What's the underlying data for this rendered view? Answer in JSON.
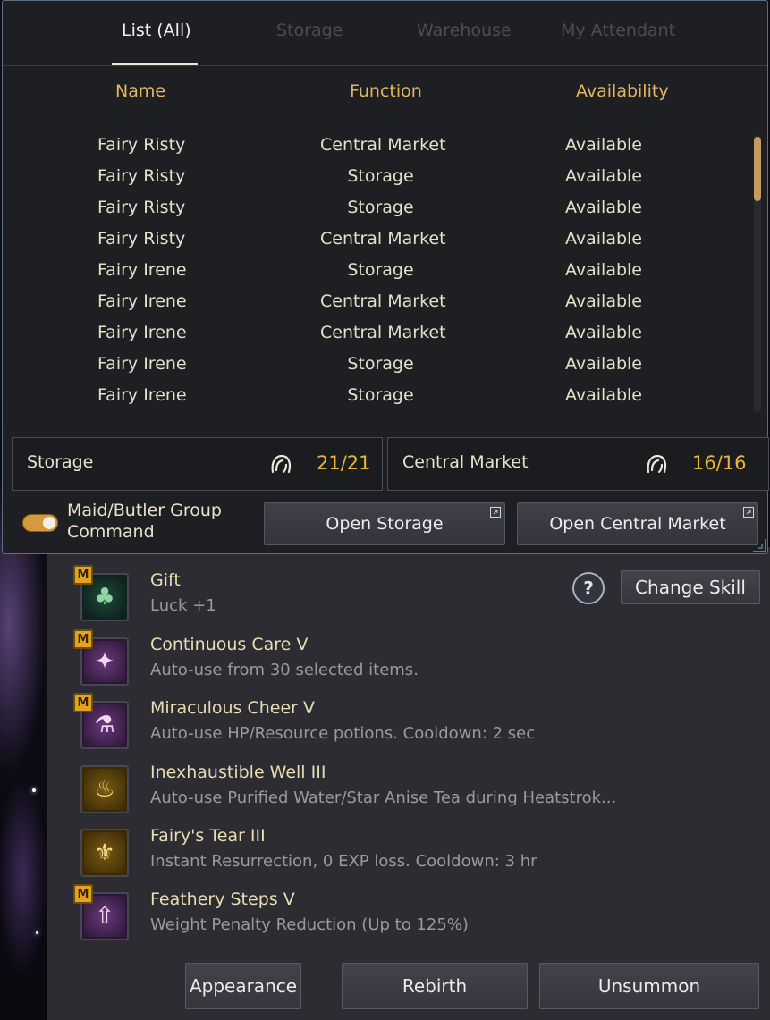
{
  "tabs": [
    {
      "label": "List (All)",
      "active": true
    },
    {
      "label": "Storage",
      "active": false
    },
    {
      "label": "Warehouse",
      "active": false
    },
    {
      "label": "My Attendant",
      "active": false
    }
  ],
  "columns": {
    "name": "Name",
    "function": "Function",
    "availability": "Availability"
  },
  "rows": [
    {
      "name": "Fairy Risty",
      "function": "Central Market",
      "availability": "Available"
    },
    {
      "name": "Fairy Risty",
      "function": "Storage",
      "availability": "Available"
    },
    {
      "name": "Fairy Risty",
      "function": "Storage",
      "availability": "Available"
    },
    {
      "name": "Fairy Risty",
      "function": "Central Market",
      "availability": "Available"
    },
    {
      "name": "Fairy Irene",
      "function": "Storage",
      "availability": "Available"
    },
    {
      "name": "Fairy Irene",
      "function": "Central Market",
      "availability": "Available"
    },
    {
      "name": "Fairy Irene",
      "function": "Central Market",
      "availability": "Available"
    },
    {
      "name": "Fairy Irene",
      "function": "Storage",
      "availability": "Available"
    },
    {
      "name": "Fairy Irene",
      "function": "Storage",
      "availability": "Available"
    }
  ],
  "summary": {
    "storage": {
      "label": "Storage",
      "count": "21/21"
    },
    "market": {
      "label": "Central Market",
      "count": "16/16"
    }
  },
  "group_command": {
    "label_line1": "Maid/Butler Group",
    "label_line2": "Command",
    "enabled": true
  },
  "buttons": {
    "open_storage": "Open Storage",
    "open_market": "Open Central Market",
    "help": "?",
    "change_skill": "Change Skill",
    "appearance": "Appearance",
    "rebirth": "Rebirth",
    "unsummon": "Unsummon"
  },
  "skills": [
    {
      "name": "Gift",
      "desc": "Luck +1",
      "badge": "M",
      "icon": "clover-icon"
    },
    {
      "name": "Continuous Care V",
      "desc": "Auto-use from 30 selected items.",
      "badge": "M",
      "icon": "fairy-icon"
    },
    {
      "name": "Miraculous Cheer V",
      "desc": "Auto-use HP/Resource potions. Cooldown: 2 sec",
      "badge": "M",
      "icon": "potion-icon"
    },
    {
      "name": "Inexhaustible Well III",
      "desc": "Auto-use Purified Water/Star Anise Tea during Heatstrok...",
      "badge": "",
      "icon": "tea-bowl-icon"
    },
    {
      "name": "Fairy's Tear III",
      "desc": "Instant Resurrection, 0 EXP loss. Cooldown: 3 hr",
      "badge": "",
      "icon": "winged-vial-icon"
    },
    {
      "name": "Feathery Steps V",
      "desc": "Weight Penalty Reduction (Up to 125%)",
      "badge": "M",
      "icon": "weight-arrow-icon"
    }
  ],
  "colors": {
    "accent_gold": "#e2b65f",
    "count_gold": "#e6b53a",
    "toggle_on": "#d69a3e",
    "scroll_thumb": "#c49a60"
  }
}
